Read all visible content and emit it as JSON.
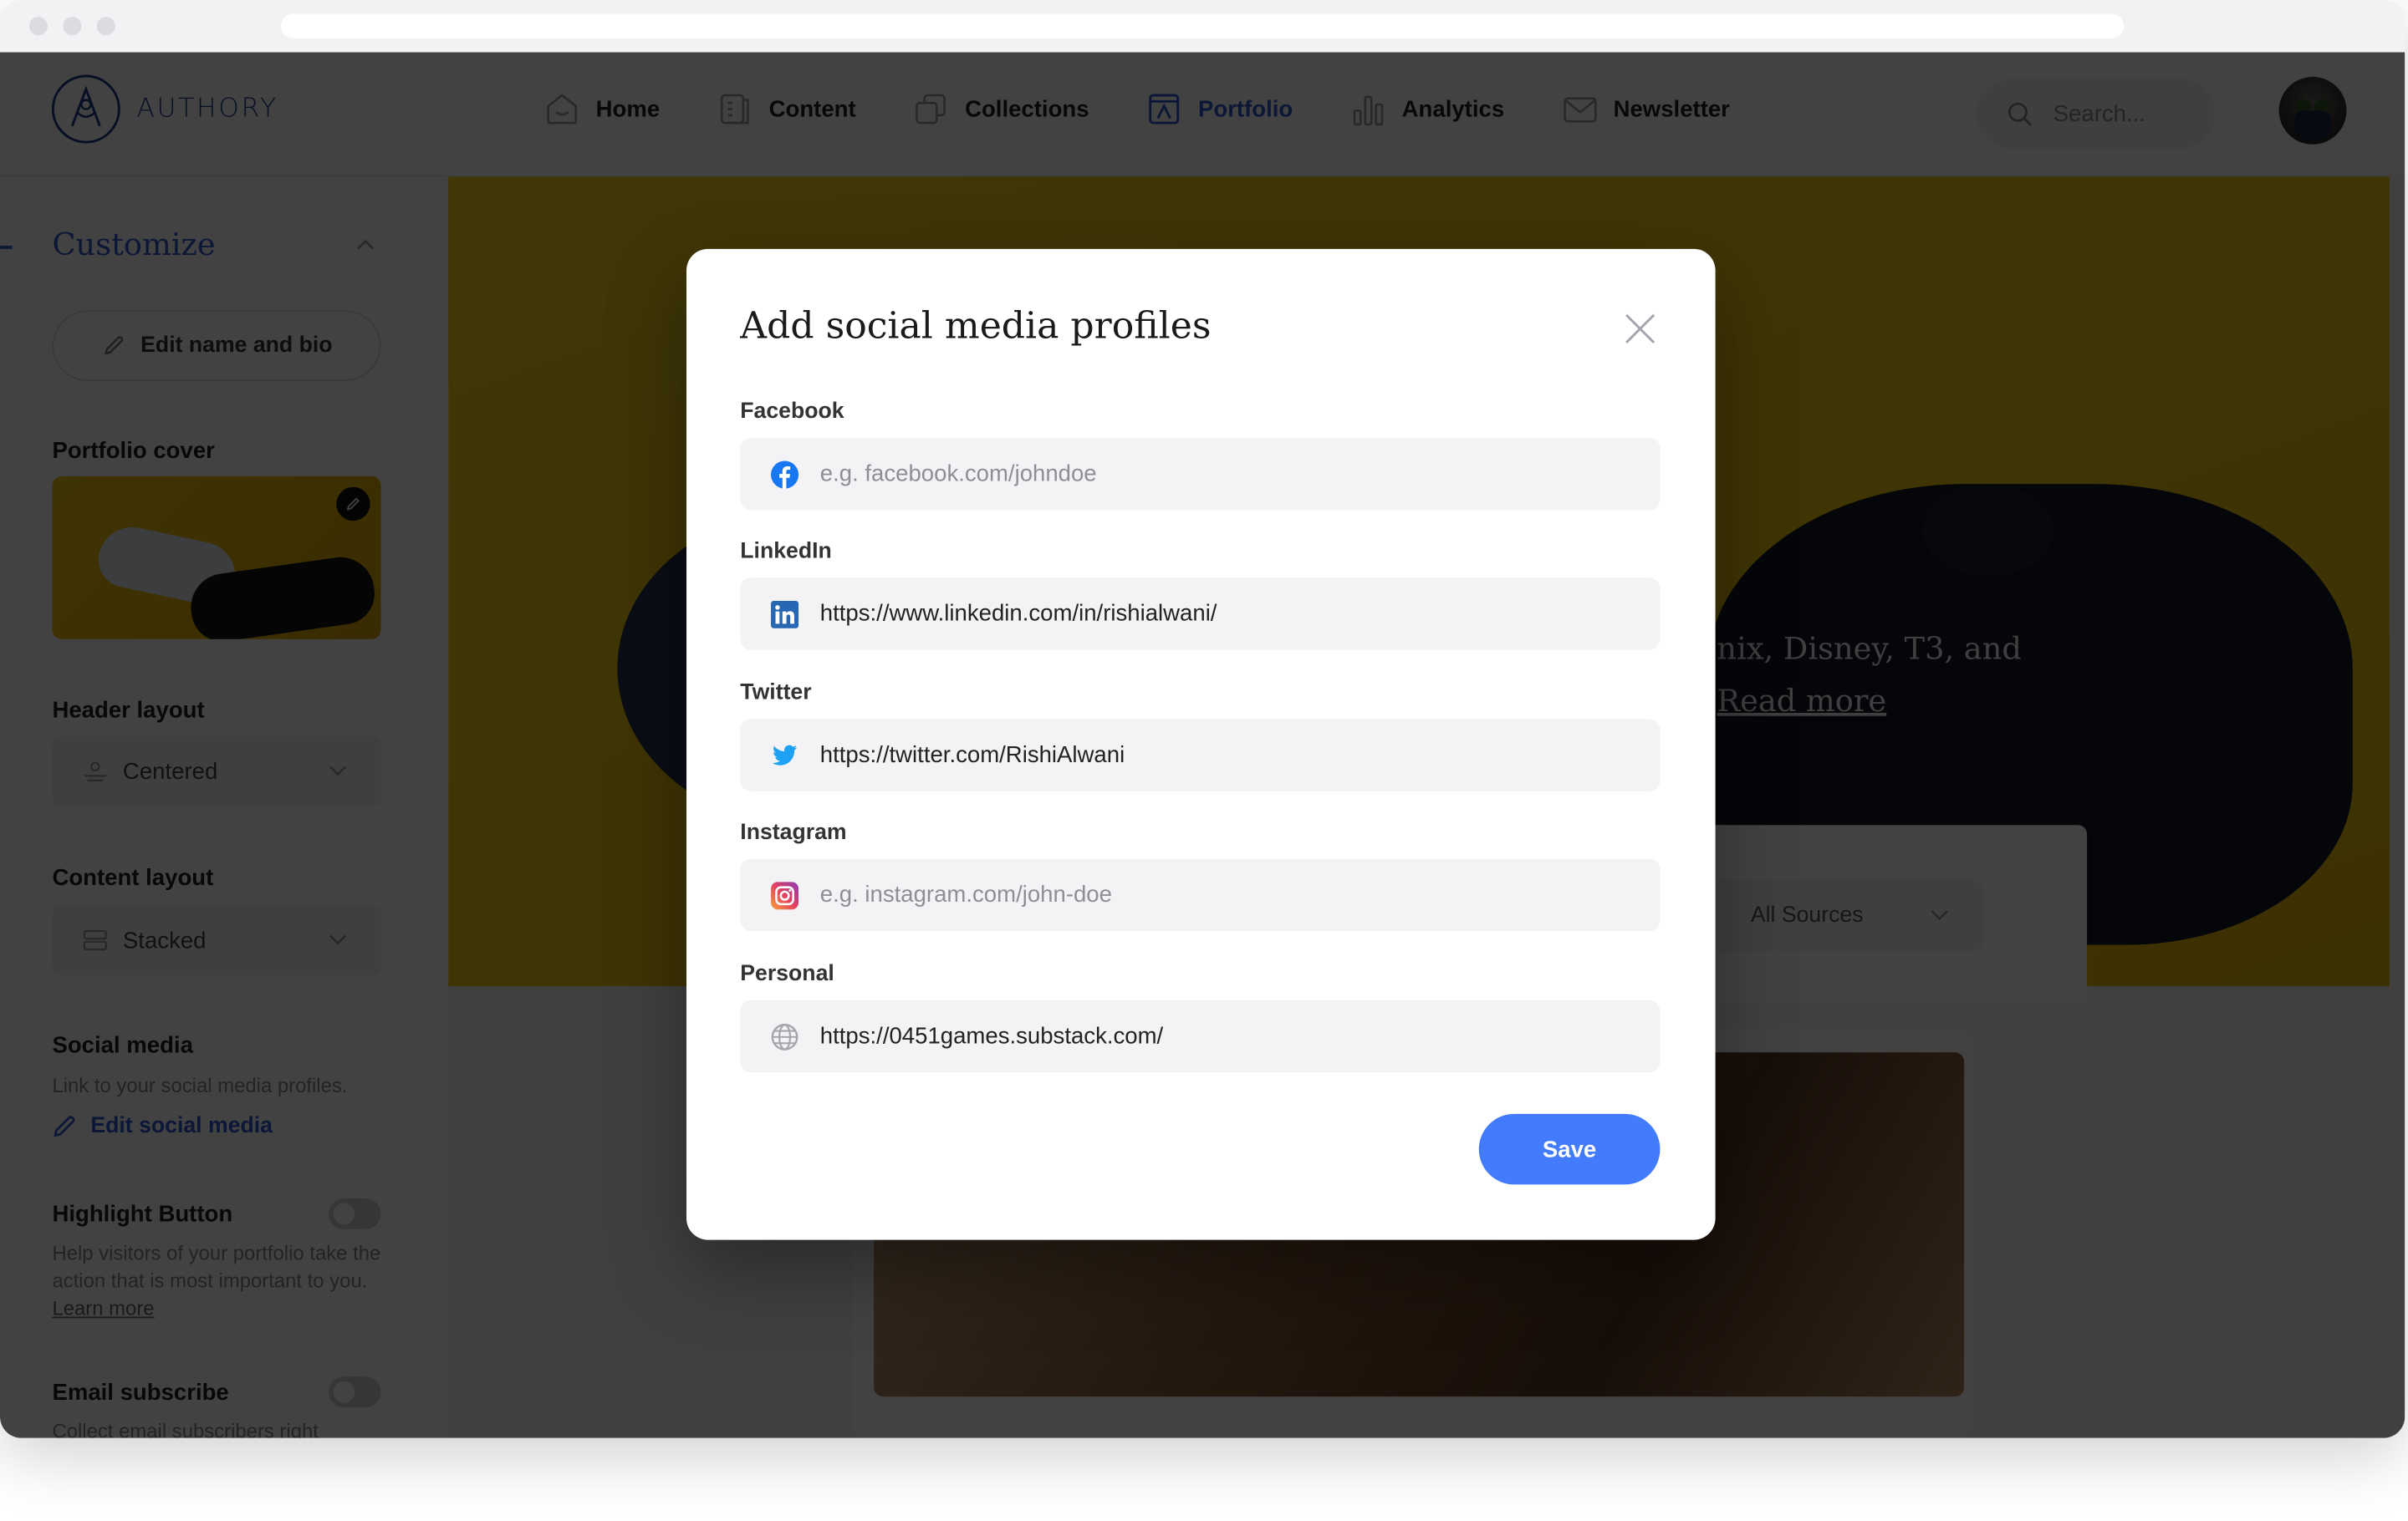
{
  "app": {
    "brand": "AUTHORY",
    "nav": [
      {
        "label": "Home",
        "icon": "home-icon",
        "active": false
      },
      {
        "label": "Content",
        "icon": "content-icon",
        "active": false
      },
      {
        "label": "Collections",
        "icon": "collections-icon",
        "active": false
      },
      {
        "label": "Portfolio",
        "icon": "portfolio-icon",
        "active": true
      },
      {
        "label": "Analytics",
        "icon": "analytics-icon",
        "active": false
      },
      {
        "label": "Newsletter",
        "icon": "newsletter-icon",
        "active": false
      }
    ],
    "search": {
      "placeholder": "Search..."
    }
  },
  "sidebar": {
    "title": "Customize",
    "edit_bio_label": "Edit name and bio",
    "portfolio_cover_label": "Portfolio cover",
    "header_layout": {
      "label": "Header layout",
      "value": "Centered"
    },
    "content_layout": {
      "label": "Content layout",
      "value": "Stacked"
    },
    "social_media": {
      "label": "Social media",
      "description": "Link to your social media profiles.",
      "edit_label": "Edit social media"
    },
    "highlight_button": {
      "label": "Highlight Button",
      "enabled": false,
      "description": "Help visitors of your portfolio take the action that is most important to you.",
      "learn_more": "Learn more"
    },
    "email_subscribe": {
      "label": "Email subscribe",
      "enabled": false,
      "description": "Collect email subscribers right"
    }
  },
  "main": {
    "hero_text_line1": "nix, Disney, T3, and",
    "hero_read_more": "Read more",
    "source_filter": "All Sources"
  },
  "modal": {
    "title": "Add social media profiles",
    "fields": [
      {
        "label": "Facebook",
        "icon": "facebook-icon",
        "value": "",
        "placeholder": "e.g. facebook.com/johndoe"
      },
      {
        "label": "LinkedIn",
        "icon": "linkedin-icon",
        "value": "https://www.linkedin.com/in/rishialwani/",
        "placeholder": ""
      },
      {
        "label": "Twitter",
        "icon": "twitter-icon",
        "value": "https://twitter.com/RishiAlwani",
        "placeholder": ""
      },
      {
        "label": "Instagram",
        "icon": "instagram-icon",
        "value": "",
        "placeholder": "e.g. instagram.com/john-doe"
      },
      {
        "label": "Personal",
        "icon": "globe-icon",
        "value": "https://0451games.substack.com/",
        "placeholder": ""
      }
    ],
    "save_label": "Save"
  },
  "colors": {
    "accent": "#2f5bd3",
    "save_button": "#437bfd",
    "facebook": "#1877f2",
    "linkedin": "#2867b2",
    "twitter": "#1da1f2"
  }
}
